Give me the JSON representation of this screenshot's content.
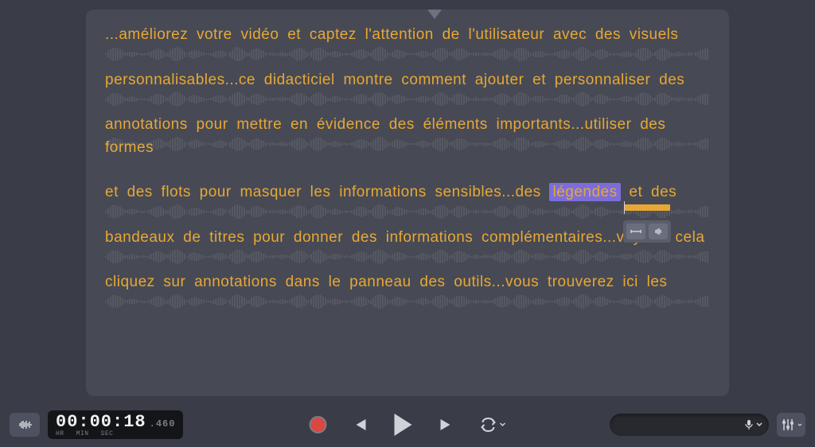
{
  "transcript": {
    "lines": [
      "...améliorez votre vidéo et captez l'attention de l'utilisateur avec des visuels",
      "personnalisables...ce didacticiel montre comment ajouter et personnaliser des",
      "annotations pour mettre en évidence des éléments importants...utiliser des formes",
      {
        "pre": "et des flots pour masquer les informations sensibles...des ",
        "highlight": "légendes",
        "post": " et des"
      },
      "bandeaux de titres pour donner des informations complémentaires...voyons cela",
      "cliquez sur annotations dans le panneau des outils...vous trouverez ici les"
    ]
  },
  "timecode": {
    "hr": "00",
    "min": "00",
    "sec": "18",
    "ms": ".460",
    "labels": {
      "hr": "HR",
      "min": "MIN",
      "sec": "SEC"
    }
  },
  "colors": {
    "text": "#e8a735",
    "highlight_bg": "#7b6edb",
    "record": "#d94842",
    "panel": "#474a54",
    "bg": "#3a3d47"
  }
}
